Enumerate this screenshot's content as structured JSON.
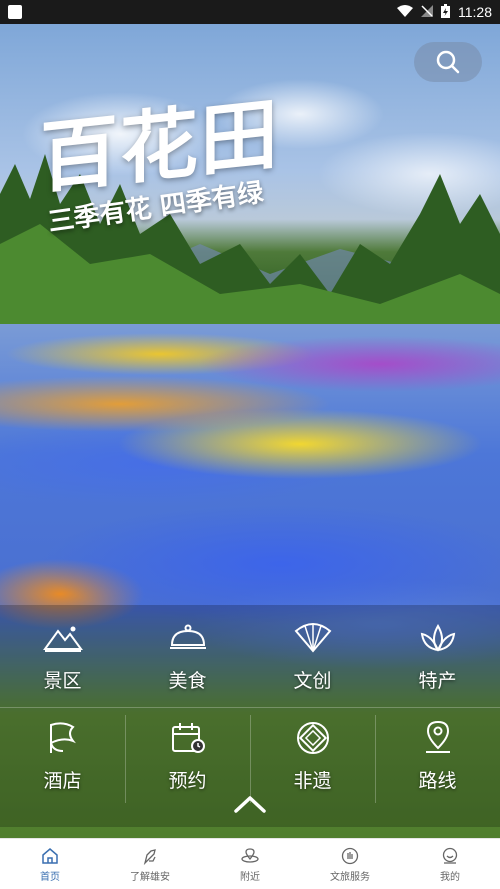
{
  "status_bar": {
    "time": "11:28"
  },
  "hero": {
    "title": "百花田",
    "subtitle": "三季有花 四季有绿"
  },
  "search": {
    "icon": "search-icon"
  },
  "grid": {
    "row1": [
      {
        "label": "景区",
        "icon": "mountain-icon"
      },
      {
        "label": "美食",
        "icon": "food-cloche-icon"
      },
      {
        "label": "文创",
        "icon": "fan-icon"
      },
      {
        "label": "特产",
        "icon": "lotus-icon"
      }
    ],
    "row2": [
      {
        "label": "酒店",
        "icon": "hotel-flag-icon"
      },
      {
        "label": "预约",
        "icon": "calendar-clock-icon"
      },
      {
        "label": "非遗",
        "icon": "heritage-pattern-icon"
      },
      {
        "label": "路线",
        "icon": "location-pin-icon"
      }
    ]
  },
  "bottom_nav": {
    "items": [
      {
        "label": "首页",
        "icon": "home-icon",
        "active": true
      },
      {
        "label": "了解雄安",
        "icon": "explore-icon",
        "active": false
      },
      {
        "label": "附近",
        "icon": "nearby-icon",
        "active": false
      },
      {
        "label": "文旅服务",
        "icon": "service-icon",
        "active": false
      },
      {
        "label": "我的",
        "icon": "profile-icon",
        "active": false
      }
    ]
  },
  "colors": {
    "accent": "#3a6fb0",
    "nav_text": "#666666"
  }
}
